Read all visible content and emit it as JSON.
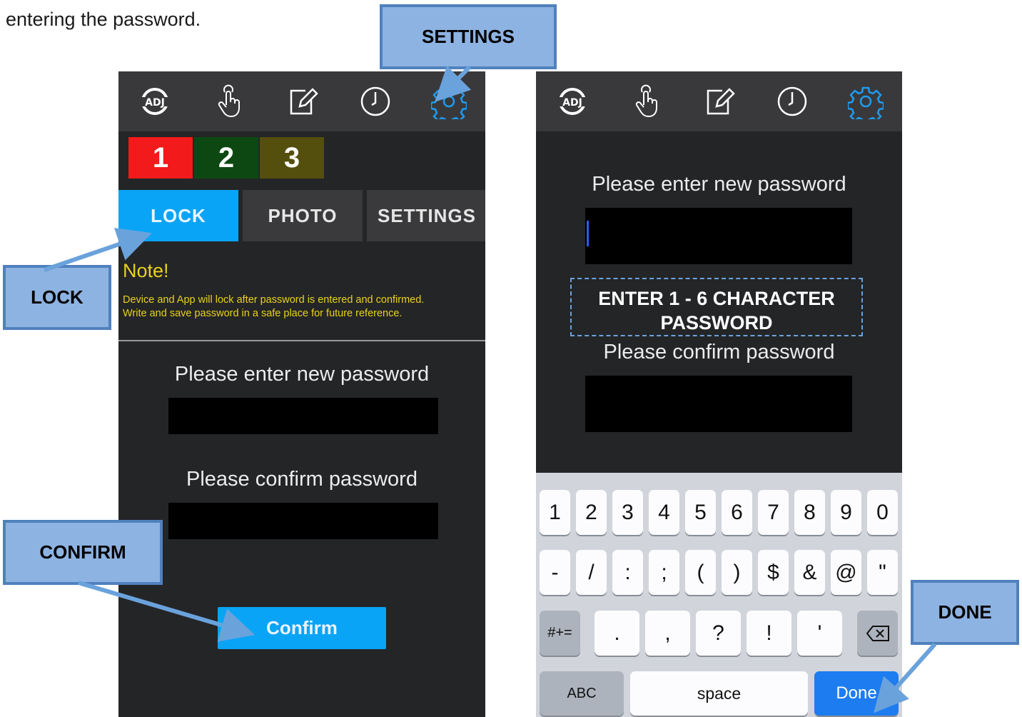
{
  "intro_text": "entering the password.",
  "left_phone": {
    "channels": [
      {
        "label": "1",
        "color": "#f21a1a"
      },
      {
        "label": "2",
        "color": "#0d4812"
      },
      {
        "label": "3",
        "color": "#554f0e"
      }
    ],
    "segments": [
      {
        "label": "LOCK",
        "active": true
      },
      {
        "label": "PHOTO",
        "active": false
      },
      {
        "label": "SETTINGS",
        "active": false
      }
    ],
    "note_title": "Note!",
    "note_line1": "Device and App will lock after password is entered and confirmed.",
    "note_line2": "Write and save password in a safe place for future reference.",
    "new_password_label": "Please enter new password",
    "confirm_password_label": "Please confirm password",
    "confirm_button": "Confirm"
  },
  "right_phone": {
    "new_password_label": "Please enter new password",
    "confirm_password_label": "Please confirm password",
    "hint": "ENTER 1 - 6 CHARACTER PASSWORD",
    "keyboard": {
      "row1": [
        "1",
        "2",
        "3",
        "4",
        "5",
        "6",
        "7",
        "8",
        "9",
        "0"
      ],
      "row2": [
        "-",
        "/",
        ":",
        ";",
        "(",
        ")",
        "$",
        "&",
        "@",
        "\""
      ],
      "row3_shift": "#+=",
      "row3": [
        ".",
        ",",
        "?",
        "!",
        "'"
      ],
      "abc": "ABC",
      "space": "space",
      "done": "Done"
    }
  },
  "tab_icons": [
    "adj-logo-icon",
    "touch-hand-icon",
    "edit-pencil-icon",
    "clock-icon",
    "settings-gear-icon"
  ],
  "callouts": {
    "settings": "SETTINGS",
    "lock": "LOCK",
    "confirm": "CONFIRM",
    "done": "DONE"
  },
  "colors": {
    "accent_blue": "#0aa4f6",
    "note_yellow": "#e8d21b",
    "callout_fill": "#8db3e2",
    "callout_border": "#4f81bd"
  }
}
